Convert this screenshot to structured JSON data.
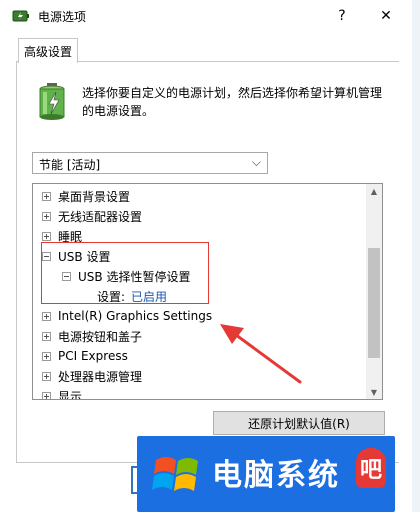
{
  "window": {
    "title": "电源选项",
    "help_glyph": "?",
    "close_glyph": "✕"
  },
  "tabs": [
    {
      "label": "高级设置"
    }
  ],
  "description": "选择你要自定义的电源计划，然后选择你希望计算机管理的电源设置。",
  "plan_select": {
    "value": "节能 [活动]"
  },
  "tree": {
    "items": [
      {
        "label": "桌面背景设置",
        "expander": "+"
      },
      {
        "label": "无线适配器设置",
        "expander": "+"
      },
      {
        "label": "睡眠",
        "expander": "+"
      },
      {
        "label": "USB 设置",
        "expander": "-"
      },
      {
        "label": "USB 选择性暂停设置",
        "expander": "-"
      },
      {
        "label": "设置:",
        "value": "已启用"
      },
      {
        "label": "Intel(R) Graphics Settings",
        "expander": "+"
      },
      {
        "label": "电源按钮和盖子",
        "expander": "+"
      },
      {
        "label": "PCI Express",
        "expander": "+"
      },
      {
        "label": "处理器电源管理",
        "expander": "+"
      },
      {
        "label": "显示",
        "expander": "+"
      }
    ]
  },
  "restore_button": "还原计划默认值(R)",
  "banner": {
    "text": "电脑系统",
    "badge": "吧"
  },
  "colors": {
    "highlight": "#e53935",
    "link": "#1a57b5",
    "banner": "#1b6fe0"
  }
}
